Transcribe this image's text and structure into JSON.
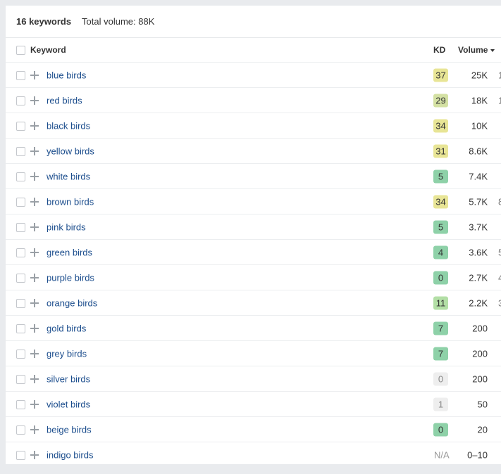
{
  "summary": {
    "count_label": "16 keywords",
    "total_label": "Total volume: 88K"
  },
  "table": {
    "headers": {
      "keyword": "Keyword",
      "kd": "KD",
      "volume": "Volume"
    },
    "rows": [
      {
        "keyword": "blue birds",
        "kd": "37",
        "kd_color": "#e8e596",
        "volume": "25K",
        "extra": "1"
      },
      {
        "keyword": "red birds",
        "kd": "29",
        "kd_color": "#d4e1a3",
        "volume": "18K",
        "extra": "1"
      },
      {
        "keyword": "black birds",
        "kd": "34",
        "kd_color": "#e8e596",
        "volume": "10K",
        "extra": ""
      },
      {
        "keyword": "yellow birds",
        "kd": "31",
        "kd_color": "#e8e596",
        "volume": "8.6K",
        "extra": ""
      },
      {
        "keyword": "white birds",
        "kd": "5",
        "kd_color": "#8ed1a8",
        "volume": "7.4K",
        "extra": ""
      },
      {
        "keyword": "brown birds",
        "kd": "34",
        "kd_color": "#e8e596",
        "volume": "5.7K",
        "extra": "8"
      },
      {
        "keyword": "pink birds",
        "kd": "5",
        "kd_color": "#8ed1a8",
        "volume": "3.7K",
        "extra": ""
      },
      {
        "keyword": "green birds",
        "kd": "4",
        "kd_color": "#8ed1a8",
        "volume": "3.6K",
        "extra": "5"
      },
      {
        "keyword": "purple birds",
        "kd": "0",
        "kd_color": "#8ed1a8",
        "volume": "2.7K",
        "extra": "4"
      },
      {
        "keyword": "orange birds",
        "kd": "11",
        "kd_color": "#b3dfa6",
        "volume": "2.2K",
        "extra": "3"
      },
      {
        "keyword": "gold birds",
        "kd": "7",
        "kd_color": "#8ed1a8",
        "volume": "200",
        "extra": ""
      },
      {
        "keyword": "grey birds",
        "kd": "7",
        "kd_color": "#8ed1a8",
        "volume": "200",
        "extra": ""
      },
      {
        "keyword": "silver birds",
        "kd": "0",
        "kd_color": "#eeeeee",
        "volume": "200",
        "extra": ""
      },
      {
        "keyword": "violet birds",
        "kd": "1",
        "kd_color": "#eeeeee",
        "volume": "50",
        "extra": ""
      },
      {
        "keyword": "beige birds",
        "kd": "0",
        "kd_color": "#8ed1a8",
        "volume": "20",
        "extra": ""
      },
      {
        "keyword": "indigo birds",
        "kd": "N/A",
        "kd_color": "",
        "volume": "0–10",
        "extra": ""
      }
    ]
  },
  "colors": {
    "link": "#1a4c8c",
    "kd_muted_text": "#999999"
  },
  "icons": {
    "add": "plus-icon",
    "sort": "caret-down-icon",
    "checkbox": "checkbox"
  }
}
